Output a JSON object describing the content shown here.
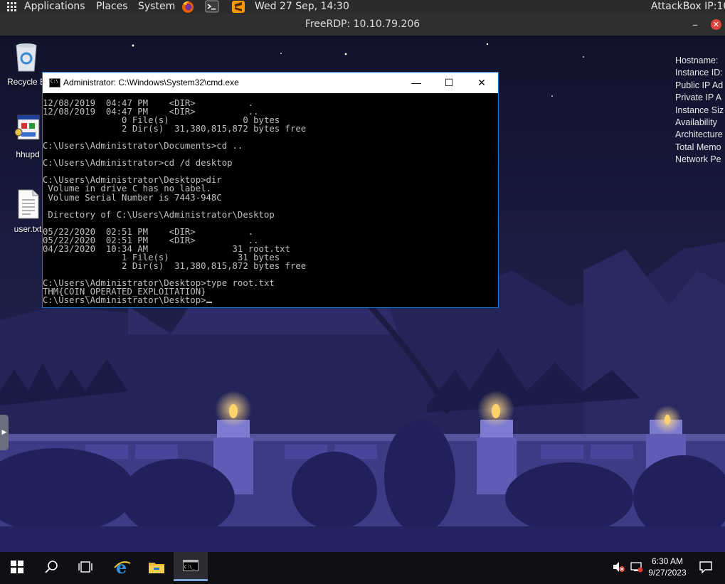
{
  "top_panel": {
    "applications": "Applications",
    "places": "Places",
    "system": "System",
    "datetime": "Wed 27 Sep, 14:30",
    "attackbox_ip": "AttackBox IP:10",
    "icons": [
      "apps-grid-icon",
      "firefox-icon",
      "terminal-icon",
      "sublime-text-icon"
    ]
  },
  "rdp_window": {
    "title": "FreeRDP: 10.10.79.206",
    "minimize": "–",
    "close": "✕"
  },
  "desktop_icons": [
    {
      "label": "Recycle B",
      "icon": "recycle-bin-icon"
    },
    {
      "label": "hhupd",
      "icon": "installer-icon"
    },
    {
      "label": "user.txt",
      "icon": "text-file-icon"
    }
  ],
  "instance_info": [
    "Hostname:",
    "Instance ID:",
    "Public IP Ad",
    "Private IP A",
    "Instance Siz",
    "Availability",
    "Architecture",
    "Total Memo",
    "Network Pe"
  ],
  "cmd_window": {
    "title": "Administrator: C:\\Windows\\System32\\cmd.exe",
    "minimize": "—",
    "maximize": "☐",
    "close": "✕",
    "lines": [
      "12/08/2019  04:47 PM    <DIR>          .",
      "12/08/2019  04:47 PM    <DIR>          ..",
      "               0 File(s)              0 bytes",
      "               2 Dir(s)  31,380,815,872 bytes free",
      "",
      "C:\\Users\\Administrator\\Documents>cd ..",
      "",
      "C:\\Users\\Administrator>cd /d desktop",
      "",
      "C:\\Users\\Administrator\\Desktop>dir",
      " Volume in drive C has no label.",
      " Volume Serial Number is 7443-948C",
      "",
      " Directory of C:\\Users\\Administrator\\Desktop",
      "",
      "05/22/2020  02:51 PM    <DIR>          .",
      "05/22/2020  02:51 PM    <DIR>          ..",
      "04/23/2020  10:34 AM                31 root.txt",
      "               1 File(s)             31 bytes",
      "               2 Dir(s)  31,380,815,872 bytes free",
      "",
      "C:\\Users\\Administrator\\Desktop>type root.txt",
      "THM{COIN_OPERATED_EXPLOITATION}",
      "C:\\Users\\Administrator\\Desktop>"
    ]
  },
  "taskbar": {
    "buttons": [
      "start-icon",
      "search-icon",
      "task-view-icon",
      "internet-explorer-icon",
      "file-explorer-icon",
      "cmd-icon"
    ],
    "time": "6:30 AM",
    "date": "9/27/2023",
    "tray_icons": [
      "speaker-muted-icon",
      "network-icon",
      "notifications-icon"
    ]
  },
  "colors": {
    "top_panel": "#2b2b2b",
    "rdp_title": "#2f2f2f",
    "cmd_border": "#1b75d0",
    "cmd_text": "#c0c0c0",
    "taskbar": "#0f0f14"
  }
}
